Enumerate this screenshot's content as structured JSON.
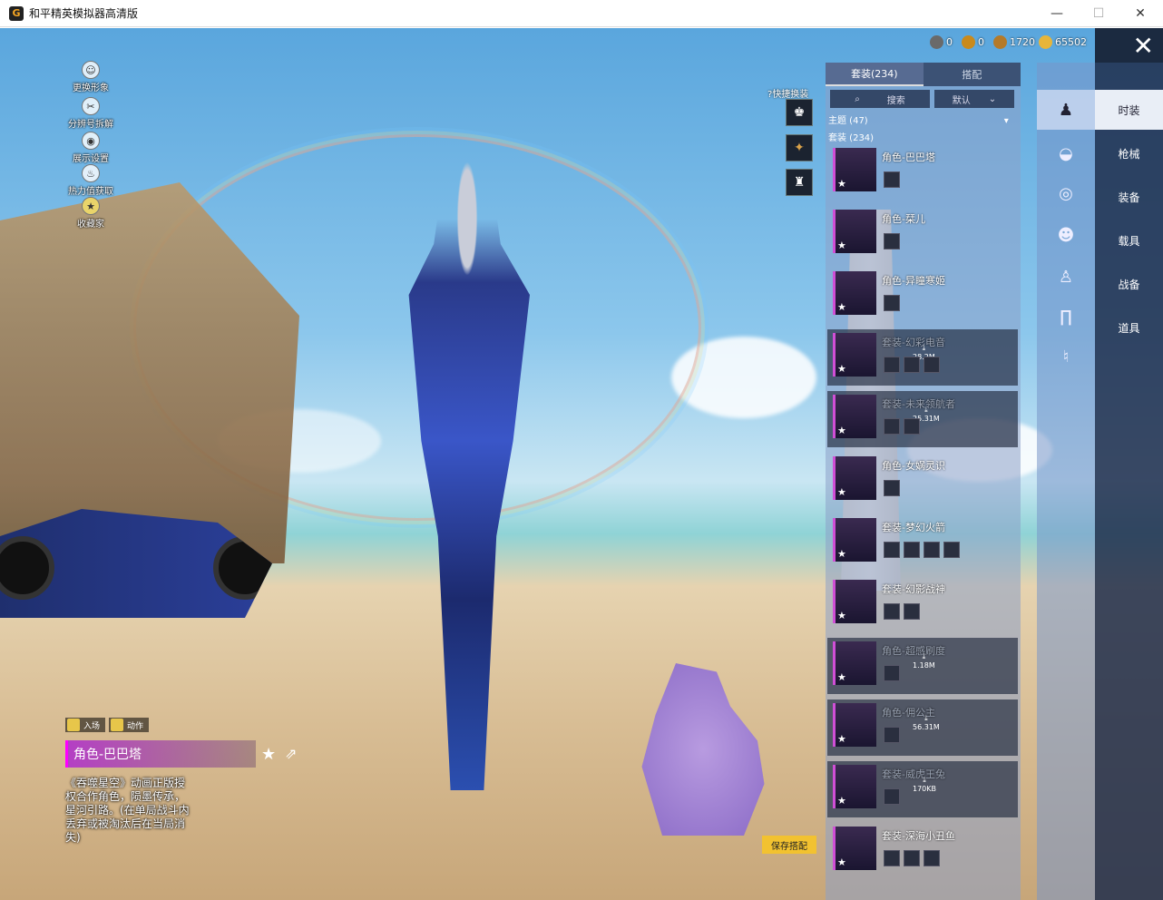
{
  "window": {
    "title": "和平精英模拟器高清版",
    "controls": [
      "—",
      "☐",
      "✕"
    ]
  },
  "left_menu": [
    {
      "label": "更换形象",
      "icon": "person-icon"
    },
    {
      "label": "分辨号拆解",
      "icon": "split-icon"
    },
    {
      "label": "展示设置",
      "icon": "eye-icon"
    },
    {
      "label": "热力值获取",
      "icon": "flame-icon"
    },
    {
      "label": "收藏家",
      "icon": "medal-icon"
    }
  ],
  "currencies": [
    {
      "value": "0",
      "color": "#6a6a6a"
    },
    {
      "value": "0",
      "color": "#c98a1c"
    },
    {
      "value": "1720",
      "color": "#b47a2a"
    },
    {
      "value": "65502",
      "color": "#e7b53a"
    }
  ],
  "quick_switch": {
    "label": "快捷换装",
    "help_icon": "help-icon"
  },
  "list_panel": {
    "tabs": [
      {
        "label": "套装(234)",
        "active": true
      },
      {
        "label": "搭配",
        "active": false
      }
    ],
    "search_label": "搜索",
    "sort_label": "默认",
    "filters": [
      {
        "label": "主题 (47)"
      },
      {
        "label": "套装 (234)"
      }
    ],
    "items": [
      {
        "name": "角色-巴巴塔",
        "faded": false,
        "subs": 1,
        "download": ""
      },
      {
        "name": "角色-栞儿",
        "faded": false,
        "subs": 1,
        "download": ""
      },
      {
        "name": "角色-异瞳寒姬",
        "faded": false,
        "subs": 1,
        "download": ""
      },
      {
        "name": "套装-幻彩电音",
        "faded": true,
        "subs": 3,
        "download": "28.2M"
      },
      {
        "name": "套装-未来领航者",
        "faded": true,
        "subs": 2,
        "download": "25.31M"
      },
      {
        "name": "角色-女娲灵识",
        "faded": false,
        "subs": 1,
        "download": ""
      },
      {
        "name": "套装-梦幻火箭",
        "faded": false,
        "subs": 4,
        "download": ""
      },
      {
        "name": "套装-幻影战神",
        "faded": false,
        "subs": 2,
        "download": ""
      },
      {
        "name": "角色-超感刷度",
        "faded": true,
        "subs": 1,
        "download": "1.18M"
      },
      {
        "name": "角色-佣公主",
        "faded": true,
        "subs": 1,
        "download": "56.31M"
      },
      {
        "name": "套装-威虎王兔",
        "faded": true,
        "subs": 1,
        "download": "170KB"
      },
      {
        "name": "套装-深海小丑鱼",
        "faded": false,
        "subs": 3,
        "download": ""
      }
    ]
  },
  "categories": [
    {
      "label": "时装",
      "icon": "outfit-icon",
      "active": true
    },
    {
      "label": "枪械",
      "icon": "hat-icon",
      "active": false
    },
    {
      "label": "装备",
      "icon": "goggles-icon",
      "active": false
    },
    {
      "label": "载具",
      "icon": "mask-icon",
      "active": false
    },
    {
      "label": "战备",
      "icon": "body-icon",
      "active": false
    },
    {
      "label": "道具",
      "icon": "pants-icon",
      "active": false
    },
    {
      "label": "",
      "icon": "shoes-icon",
      "active": false
    }
  ],
  "character": {
    "tags": [
      "入场",
      "动作"
    ],
    "name": "角色-巴巴塔",
    "description": "《吞噬星空》动画正版授权合作角色，陨墨传承，星河引路。(在单局战斗内丢弃或被淘汰后在当局消失)"
  },
  "save_button": "保存搭配"
}
